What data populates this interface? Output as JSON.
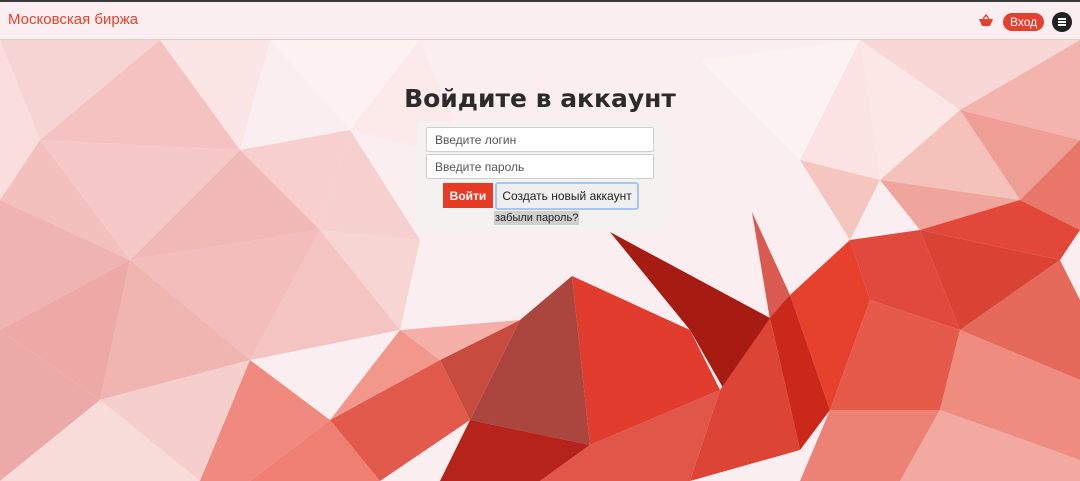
{
  "navbar": {
    "brand": "Московская биржа",
    "cart_icon": "cart-icon",
    "login_label": "Вход",
    "menu_icon": "menu-icon"
  },
  "main": {
    "title": "Войдите в аккаунт"
  },
  "login_form": {
    "login_placeholder": "Введите логин",
    "login_value": "",
    "password_placeholder": "Введите пароль",
    "password_value": "",
    "submit_label": "Войти",
    "create_label": "Создать новый аккаунт",
    "forgot_label": "забыли пароль?"
  },
  "colors": {
    "accent": "#e4412e",
    "panel": "#f3f2f1",
    "text_dark": "#2b2b2b"
  }
}
